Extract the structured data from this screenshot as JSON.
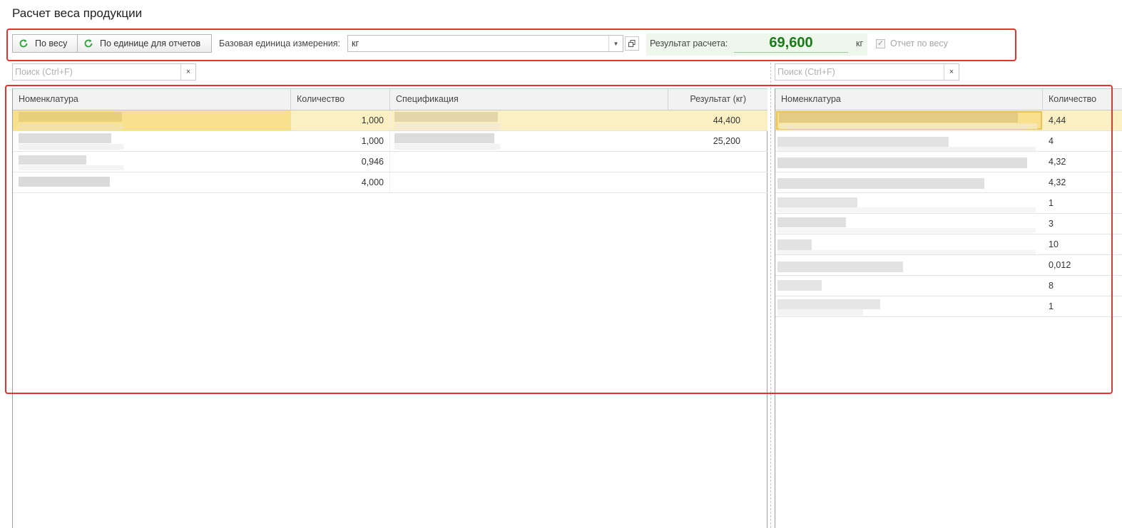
{
  "page": {
    "title": "Расчет веса продукции"
  },
  "toolbar": {
    "by_weight_label": "По весу",
    "by_report_unit_label": "По единице для отчетов",
    "base_unit_label": "Базовая единица измерения:",
    "base_unit_value": "кг",
    "result_label": "Результат расчета:",
    "result_value": "69,600",
    "result_unit": "кг",
    "report_by_weight_label": "Отчет по весу",
    "report_by_weight_checked": true
  },
  "left_search": {
    "placeholder": "Поиск (Ctrl+F)",
    "clear_label": "×"
  },
  "right_search": {
    "placeholder": "Поиск (Ctrl+F)",
    "clear_label": "×"
  },
  "left_table": {
    "columns": [
      "Номенклатура",
      "Количество",
      "Спецификация",
      "Результат (кг)"
    ],
    "rows": [
      {
        "quantity": "1,000",
        "result": "44,400",
        "selected": true
      },
      {
        "quantity": "1,000",
        "result": "25,200",
        "selected": false
      },
      {
        "quantity": "0,946",
        "result": "",
        "selected": false
      },
      {
        "quantity": "4,000",
        "result": "",
        "selected": false
      }
    ]
  },
  "right_table": {
    "columns": [
      "Номенклатура",
      "Количество"
    ],
    "rows": [
      {
        "quantity": "4,44",
        "selected": true
      },
      {
        "quantity": "4",
        "selected": false
      },
      {
        "quantity": "4,32",
        "selected": false
      },
      {
        "quantity": "4,32",
        "selected": false
      },
      {
        "quantity": "1",
        "selected": false
      },
      {
        "quantity": "3",
        "selected": false
      },
      {
        "quantity": "10",
        "selected": false
      },
      {
        "quantity": "0,012",
        "selected": false
      },
      {
        "quantity": "8",
        "selected": false
      },
      {
        "quantity": "1",
        "selected": false
      }
    ]
  },
  "colors": {
    "highlight_border": "#e3342f",
    "result_value": "#1a7a1a",
    "selected_row": "#fbf0c4",
    "selected_cell": "#f9e08c"
  },
  "icons": {
    "refresh": "refresh-icon",
    "dropdown": "chevron-down-icon",
    "open": "open-window-icon",
    "clear": "close-icon",
    "checkbox": "check-icon"
  }
}
